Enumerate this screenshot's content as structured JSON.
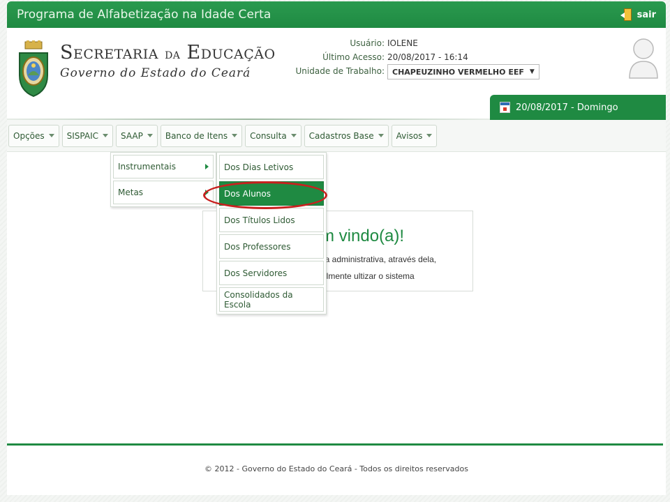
{
  "app": {
    "title": "Programa de Alfabetização na Idade Certa",
    "exit_label": "sair"
  },
  "brand": {
    "main_part1": "Secretaria",
    "main_small": "da",
    "main_part2": "Educação",
    "sub": "Governo do Estado do Ceará"
  },
  "user": {
    "user_label": "Usuário:",
    "user_value": "IOLENE",
    "last_access_label": "Último Acesso:",
    "last_access_value": "20/08/2017 - 16:14",
    "unit_label": "Unidade de Trabalho:",
    "unit_value": "CHAPEUZINHO VERMELHO EEF",
    "unit_caret": "▼"
  },
  "date_bar": {
    "text": "20/08/2017 - Domingo"
  },
  "nav": {
    "items": [
      {
        "label": "Opções"
      },
      {
        "label": "SISPAIC"
      },
      {
        "label": "SAAP"
      },
      {
        "label": "Banco de Itens"
      },
      {
        "label": "Consulta"
      },
      {
        "label": "Cadastros Base"
      },
      {
        "label": "Avisos"
      }
    ]
  },
  "submenu": {
    "items": [
      {
        "label": "Instrumentais"
      },
      {
        "label": "Metas"
      }
    ]
  },
  "metas_menu": {
    "items": [
      {
        "label": "Dos Dias Letivos"
      },
      {
        "label": "Dos Alunos"
      },
      {
        "label": "Dos Títulos Lidos"
      },
      {
        "label": "Dos Professores"
      },
      {
        "label": "Dos Servidores"
      },
      {
        "label": "Consolidados da Escola"
      }
    ],
    "active_index": 1
  },
  "welcome": {
    "title": "m vindo(a)!",
    "line1": "ea administrativa, através dela,",
    "line2": "cilmente ultizar o sistema"
  },
  "footer": {
    "text": "© 2012 - Governo do Estado do Ceará - Todos os direitos reservados"
  },
  "colors": {
    "primary_green": "#1f8a42",
    "highlight_red": "#c8211f"
  }
}
